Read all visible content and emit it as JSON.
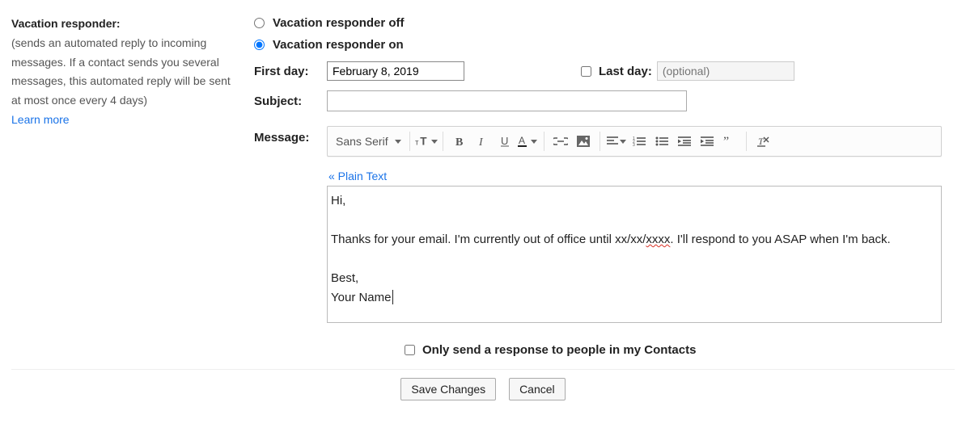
{
  "left": {
    "title": "Vacation responder:",
    "desc": "(sends an automated reply to incoming messages. If a contact sends you several messages, this automated reply will be sent at most once every 4 days)",
    "learn_more": "Learn more"
  },
  "radio": {
    "off_label": "Vacation responder off",
    "on_label": "Vacation responder on",
    "selected": "on"
  },
  "fields": {
    "first_day_label": "First day:",
    "first_day_value": "February 8, 2019",
    "last_day_label": "Last day:",
    "last_day_placeholder": "(optional)",
    "subject_label": "Subject:",
    "subject_value": "",
    "message_label": "Message:"
  },
  "toolbar": {
    "font_name": "Sans Serif"
  },
  "plain_text_link": "« Plain Text",
  "message_body": {
    "line1": "Hi,",
    "line2a": "Thanks for your email. I'm currently out of office until xx/xx/",
    "line2b_spellerr": "xxxx",
    "line2c": ". I'll respond to you ASAP when I'm back.",
    "line3": "Best,",
    "line4": "Your Name"
  },
  "contacts_only_label": "Only send a response to people in my Contacts",
  "buttons": {
    "save": "Save Changes",
    "cancel": "Cancel"
  }
}
